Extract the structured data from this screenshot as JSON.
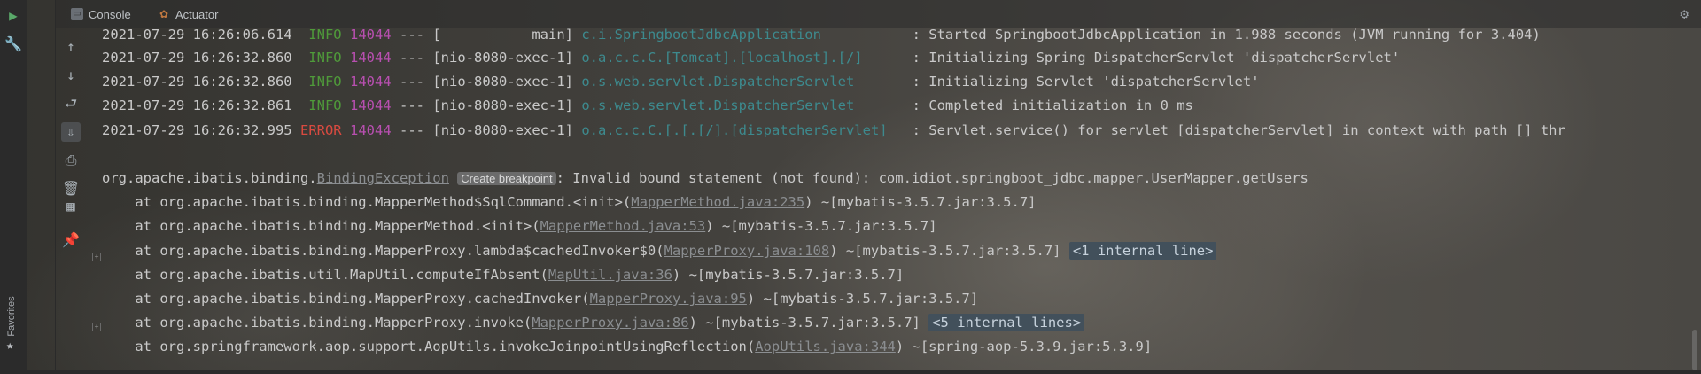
{
  "tabs": {
    "console_label": "Console",
    "actuator_label": "Actuator"
  },
  "sidebar": {
    "favorites_label": "Favorites"
  },
  "log": [
    {
      "date": "2021-07-29 16:26:06.614",
      "level": "INFO",
      "pid": "14044",
      "sep": "---",
      "thread": "[           main]",
      "logger": "c.i.SpringbootJdbcApplication",
      "message": ": Started SpringbootJdbcApplication in 1.988 seconds (JVM running for 3.404)"
    },
    {
      "date": "2021-07-29 16:26:32.860",
      "level": "INFO",
      "pid": "14044",
      "sep": "---",
      "thread": "[nio-8080-exec-1]",
      "logger": "o.a.c.c.C.[Tomcat].[localhost].[/]",
      "message": ": Initializing Spring DispatcherServlet 'dispatcherServlet'"
    },
    {
      "date": "2021-07-29 16:26:32.860",
      "level": "INFO",
      "pid": "14044",
      "sep": "---",
      "thread": "[nio-8080-exec-1]",
      "logger": "o.s.web.servlet.DispatcherServlet",
      "message": ": Initializing Servlet 'dispatcherServlet'"
    },
    {
      "date": "2021-07-29 16:26:32.861",
      "level": "INFO",
      "pid": "14044",
      "sep": "---",
      "thread": "[nio-8080-exec-1]",
      "logger": "o.s.web.servlet.DispatcherServlet",
      "message": ": Completed initialization in 0 ms"
    },
    {
      "date": "2021-07-29 16:26:32.995",
      "level": "ERROR",
      "pid": "14044",
      "sep": "---",
      "thread": "[nio-8080-exec-1]",
      "logger": "o.a.c.c.C.[.[.[/].[dispatcherServlet]",
      "message": ": Servlet.service() for servlet [dispatcherServlet] in context with path [] thr"
    }
  ],
  "exception": {
    "prefix": "org.apache.ibatis.binding.",
    "class_link": "BindingException",
    "breakpoint_chip": "Create breakpoint",
    "message": ": Invalid bound statement (not found): com.idiot.springboot_jdbc.mapper.UserMapper.getUsers"
  },
  "stack": [
    {
      "pre": "    at org.apache.ibatis.binding.MapperMethod$SqlCommand.<init>(",
      "link": "MapperMethod.java:235",
      "post": ") ~[mybatis-3.5.7.jar:3.5.7]",
      "chip": ""
    },
    {
      "pre": "    at org.apache.ibatis.binding.MapperMethod.<init>(",
      "link": "MapperMethod.java:53",
      "post": ") ~[mybatis-3.5.7.jar:3.5.7]",
      "chip": ""
    },
    {
      "pre": "    at org.apache.ibatis.binding.MapperProxy.lambda$cachedInvoker$0(",
      "link": "MapperProxy.java:108",
      "post": ") ~[mybatis-3.5.7.jar:3.5.7] ",
      "chip": "<1 internal line>"
    },
    {
      "pre": "    at org.apache.ibatis.util.MapUtil.computeIfAbsent(",
      "link": "MapUtil.java:36",
      "post": ") ~[mybatis-3.5.7.jar:3.5.7]",
      "chip": ""
    },
    {
      "pre": "    at org.apache.ibatis.binding.MapperProxy.cachedInvoker(",
      "link": "MapperProxy.java:95",
      "post": ") ~[mybatis-3.5.7.jar:3.5.7]",
      "chip": ""
    },
    {
      "pre": "    at org.apache.ibatis.binding.MapperProxy.invoke(",
      "link": "MapperProxy.java:86",
      "post": ") ~[mybatis-3.5.7.jar:3.5.7] ",
      "chip": "<5 internal lines>"
    },
    {
      "pre": "    at org.springframework.aop.support.AopUtils.invokeJoinpointUsingReflection(",
      "link": "AopUtils.java:344",
      "post": ") ~[spring-aop-5.3.9.jar:5.3.9]",
      "chip": ""
    }
  ],
  "colors": {
    "info": "#4f9a3a",
    "error": "#d84a40",
    "pid": "#b84fb0",
    "logger": "#3d8a8e"
  },
  "icons": [
    "run-icon",
    "wrench-icon",
    "console-icon",
    "actuator-icon",
    "gear-icon",
    "scroll-up-icon",
    "scroll-down-icon",
    "soft-wrap-icon",
    "scroll-to-end-icon",
    "print-icon",
    "trash-icon",
    "layout-icon",
    "pin-icon",
    "star-icon"
  ]
}
